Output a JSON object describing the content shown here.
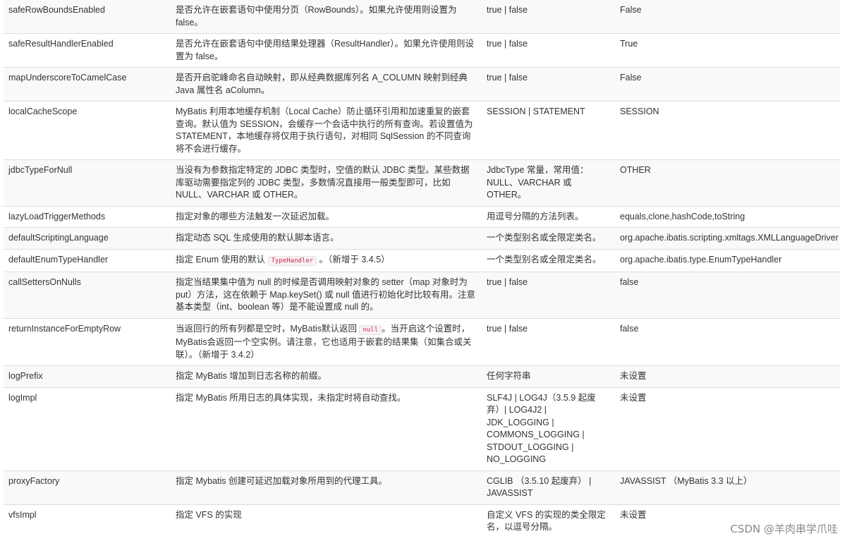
{
  "rows": [
    {
      "name": "safeRowBoundsEnabled",
      "description": "是否允许在嵌套语句中使用分页（RowBounds）。如果允许使用则设置为 false。",
      "values": "true | false",
      "default": "False"
    },
    {
      "name": "safeResultHandlerEnabled",
      "description": "是否允许在嵌套语句中使用结果处理器（ResultHandler）。如果允许使用则设置为 false。",
      "values": "true | false",
      "default": "True"
    },
    {
      "name": "mapUnderscoreToCamelCase",
      "description": "是否开启驼峰命名自动映射，即从经典数据库列名 A_COLUMN 映射到经典 Java 属性名 aColumn。",
      "values": "true | false",
      "default": "False"
    },
    {
      "name": "localCacheScope",
      "description": "MyBatis 利用本地缓存机制（Local Cache）防止循环引用和加速重复的嵌套查询。默认值为 SESSION，会缓存一个会话中执行的所有查询。若设置值为 STATEMENT，本地缓存将仅用于执行语句，对相同 SqlSession 的不同查询将不会进行缓存。",
      "values": "SESSION | STATEMENT",
      "default": "SESSION"
    },
    {
      "name": "jdbcTypeForNull",
      "description": "当没有为参数指定特定的 JDBC 类型时，空值的默认 JDBC 类型。某些数据库驱动需要指定列的 JDBC 类型，多数情况直接用一般类型即可，比如 NULL、VARCHAR 或 OTHER。",
      "values": "JdbcType 常量，常用值：NULL、VARCHAR 或 OTHER。",
      "default": "OTHER"
    },
    {
      "name": "lazyLoadTriggerMethods",
      "description": "指定对象的哪些方法触发一次延迟加载。",
      "values": "用逗号分隔的方法列表。",
      "default": "equals,clone,hashCode,toString"
    },
    {
      "name": "defaultScriptingLanguage",
      "description": "指定动态 SQL 生成使用的默认脚本语言。",
      "values": "一个类型别名或全限定类名。",
      "default": "org.apache.ibatis.scripting.xmltags.XMLLanguageDriver"
    },
    {
      "name": "defaultEnumTypeHandler",
      "description_before": "指定 Enum 使用的默认 ",
      "description_code": "TypeHandler",
      "description_after": " 。（新增于 3.4.5）",
      "values": "一个类型别名或全限定类名。",
      "default": "org.apache.ibatis.type.EnumTypeHandler"
    },
    {
      "name": "callSettersOnNulls",
      "description": "指定当结果集中值为 null 的时候是否调用映射对象的 setter（map 对象时为 put）方法，这在依赖于 Map.keySet() 或 null 值进行初始化时比较有用。注意基本类型（int、boolean 等）是不能设置成 null 的。",
      "values": "true | false",
      "default": "false"
    },
    {
      "name": "returnInstanceForEmptyRow",
      "description_before": "当返回行的所有列都是空时，MyBatis默认返回 ",
      "description_code": "null",
      "description_after": "。当开启这个设置时，MyBatis会返回一个空实例。请注意，它也适用于嵌套的结果集（如集合或关联）。（新增于 3.4.2）",
      "values": "true | false",
      "default": "false"
    },
    {
      "name": "logPrefix",
      "description": "指定 MyBatis 增加到日志名称的前缀。",
      "values": "任何字符串",
      "default": "未设置"
    },
    {
      "name": "logImpl",
      "description": "指定 MyBatis 所用日志的具体实现，未指定时将自动查找。",
      "values": "SLF4J | LOG4J（3.5.9 起废弃）| LOG4J2 | JDK_LOGGING | COMMONS_LOGGING | STDOUT_LOGGING | NO_LOGGING",
      "default": "未设置"
    },
    {
      "name": "proxyFactory",
      "description": "指定 Mybatis 创建可延迟加载对象所用到的代理工具。",
      "values": "CGLIB （3.5.10 起废弃） | JAVASSIST",
      "default": "JAVASSIST （MyBatis 3.3 以上）"
    },
    {
      "name": "vfsImpl",
      "description": "指定 VFS 的实现",
      "values": "自定义 VFS 的实现的类全限定名，以逗号分隔。",
      "default": "未设置"
    }
  ],
  "watermark": "CSDN @羊肉串学爪哇"
}
